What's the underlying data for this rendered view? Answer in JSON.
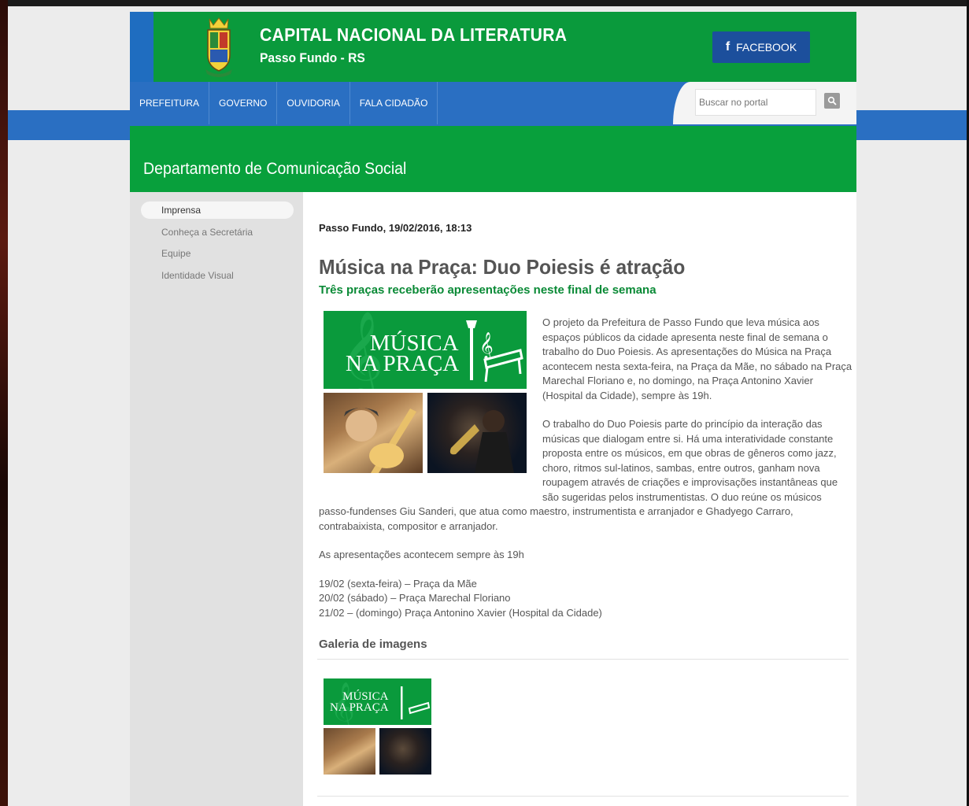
{
  "header": {
    "title": "CAPITAL NACIONAL DA LITERATURA",
    "subtitle": "Passo Fundo - RS",
    "facebook_label": "FACEBOOK"
  },
  "nav": {
    "items": [
      "PREFEITURA",
      "GOVERNO",
      "OUVIDORIA",
      "FALA CIDADÃO"
    ],
    "search_placeholder": "Buscar no portal"
  },
  "department": {
    "title": "Departamento de Comunicação Social"
  },
  "sidebar": {
    "items": [
      {
        "label": "Imprensa",
        "active": true
      },
      {
        "label": "Conheça a Secretária",
        "active": false
      },
      {
        "label": "Equipe",
        "active": false
      },
      {
        "label": "Identidade Visual",
        "active": false
      }
    ]
  },
  "article": {
    "dateline": "Passo Fundo, 19/02/2016, 18:13",
    "headline": "Música na Praça: Duo Poiesis é atração",
    "subhead": "Três praças receberão apresentações neste final de semana",
    "banner_line1": "MÚSICA",
    "banner_line2": "NA PRAÇA",
    "paragraphs": [
      "O projeto da Prefeitura de Passo Fundo que leva música aos espaços públicos da cidade apresenta neste final de semana o trabalho do Duo Poiesis. As apresentações do Música na Praça acontecem nesta sexta-feira, na Praça da Mãe, no sábado na Praça Marechal Floriano e, no domingo, na Praça Antonino Xavier (Hospital da Cidade), sempre às 19h.",
      "O trabalho do Duo Poiesis parte do princípio da interação das músicas que dialogam entre si. Há uma interatividade constante proposta entre os músicos, em que obras de gêneros como jazz, choro, ritmos sul-latinos, sambas, entre outros, ganham nova roupagem através de criações e improvisações instantâneas que são sugeridas pelos instrumentistas. O duo reúne os músicos passo-fundenses Giu Sanderi, que atua como maestro, instrumentista e arranjador e Ghadyego Carraro, contrabaixista, compositor e arranjador.",
      "As apresentações acontecem sempre às 19h"
    ],
    "schedule": [
      "19/02 (sexta-feira) – Praça da Mãe",
      "20/02 (sábado) – Praça Marechal Floriano",
      "21/02 – (domingo) Praça Antonino Xavier (Hospital da Cidade)"
    ],
    "gallery_title": "Galeria de imagens"
  },
  "colors": {
    "header_green": "#0a9a3c",
    "nav_blue": "#2a6fc2",
    "facebook_blue": "#1c4f9c",
    "subhead_green": "#0a8a36"
  }
}
